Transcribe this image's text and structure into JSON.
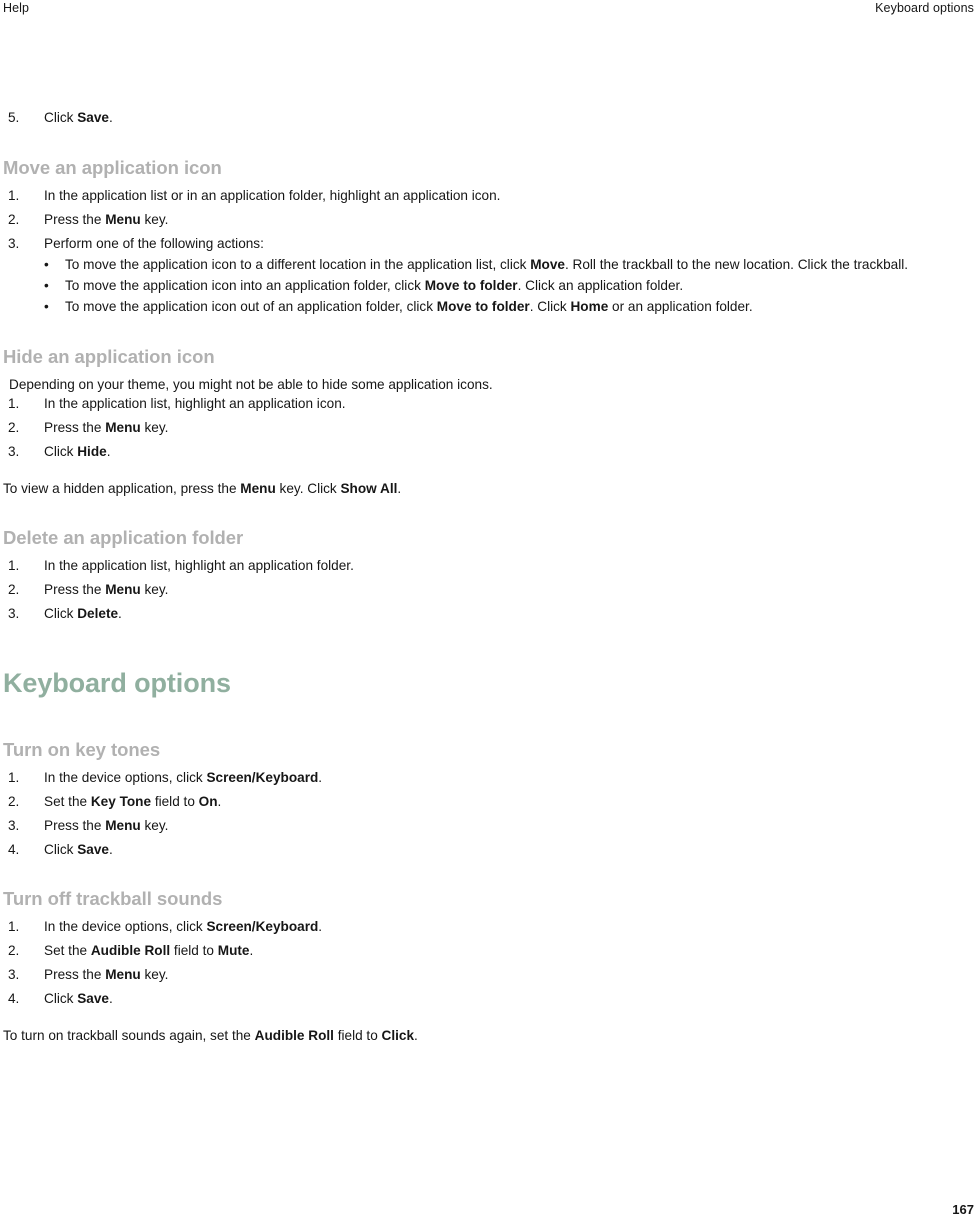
{
  "document": {
    "running_header": {
      "left": "Help",
      "right": "Keyboard options"
    },
    "folio": "167",
    "colors": {
      "chapter_heading": "#90af9f",
      "section_heading": "#b1b1b1",
      "body_text": "#161616",
      "page_background": "#ffffff"
    }
  },
  "continued_step": {
    "marker": "5.",
    "text_before": "Click ",
    "bold": "Save",
    "text_after": "."
  },
  "sections": {
    "move_application_icon": {
      "heading": "Move an application icon",
      "steps": [
        {
          "marker": "1.",
          "text": "In the application list or in an application folder, highlight an application icon."
        },
        {
          "marker": "2.",
          "pre": "Press the ",
          "bold": "Menu",
          "post": " key."
        },
        {
          "marker": "3.",
          "text": "Perform one of the following actions:",
          "bullets": [
            {
              "p1": "To move the application icon to a different location in the application list, click ",
              "b1": "Move",
              "p2": ". Roll the trackball to the new location. Click the trackball."
            },
            {
              "p1": "To move the application icon into an application folder, click ",
              "b1": "Move to folder",
              "p2": ". Click an application folder."
            },
            {
              "p1": "To move the application icon out of an application folder, click ",
              "b1": "Move to folder",
              "p2": ". Click ",
              "b2": "Home",
              "p3": " or an application folder."
            }
          ]
        }
      ]
    },
    "hide_application_icon": {
      "heading": "Hide an application icon",
      "note": "Depending on your theme, you might not be able to hide some application icons.",
      "steps": [
        {
          "marker": "1.",
          "text": "In the application list, highlight an application icon."
        },
        {
          "marker": "2.",
          "pre": "Press the ",
          "bold": "Menu",
          "post": " key."
        },
        {
          "marker": "3.",
          "pre": "Click ",
          "bold": "Hide",
          "post": "."
        }
      ],
      "trailing_paragraph": {
        "p1": "To view a hidden application, press the ",
        "b1": "Menu",
        "p2": " key. Click ",
        "b2": "Show All",
        "p3": "."
      }
    },
    "delete_application_folder": {
      "heading": "Delete an application folder",
      "steps": [
        {
          "marker": "1.",
          "text": "In the application list, highlight an application folder."
        },
        {
          "marker": "2.",
          "pre": "Press the ",
          "bold": "Menu",
          "post": " key."
        },
        {
          "marker": "3.",
          "pre": "Click ",
          "bold": "Delete",
          "post": "."
        }
      ]
    },
    "keyboard_options": {
      "heading": "Keyboard options"
    },
    "turn_on_key_tones": {
      "heading": "Turn on key tones",
      "steps": [
        {
          "marker": "1.",
          "pre": "In the device options, click ",
          "bold": "Screen/Keyboard",
          "post": "."
        },
        {
          "marker": "2.",
          "pre": "Set the ",
          "bold": "Key Tone",
          "mid": " field to ",
          "bold2": "On",
          "post": "."
        },
        {
          "marker": "3.",
          "pre": "Press the ",
          "bold": "Menu",
          "post": " key."
        },
        {
          "marker": "4.",
          "pre": "Click ",
          "bold": "Save",
          "post": "."
        }
      ]
    },
    "turn_off_trackball_sounds": {
      "heading": "Turn off trackball sounds",
      "steps": [
        {
          "marker": "1.",
          "pre": "In the device options, click ",
          "bold": "Screen/Keyboard",
          "post": "."
        },
        {
          "marker": "2.",
          "pre": "Set the ",
          "bold": "Audible Roll",
          "mid": " field to ",
          "bold2": "Mute",
          "post": "."
        },
        {
          "marker": "3.",
          "pre": "Press the ",
          "bold": "Menu",
          "post": " key."
        },
        {
          "marker": "4.",
          "pre": "Click ",
          "bold": "Save",
          "post": "."
        }
      ],
      "trailing_paragraph": {
        "p1": "To turn on trackball sounds again, set the ",
        "b1": "Audible Roll",
        "p2": " field to ",
        "b2": "Click",
        "p3": "."
      }
    }
  },
  "symbols": {
    "bullet": "•"
  }
}
